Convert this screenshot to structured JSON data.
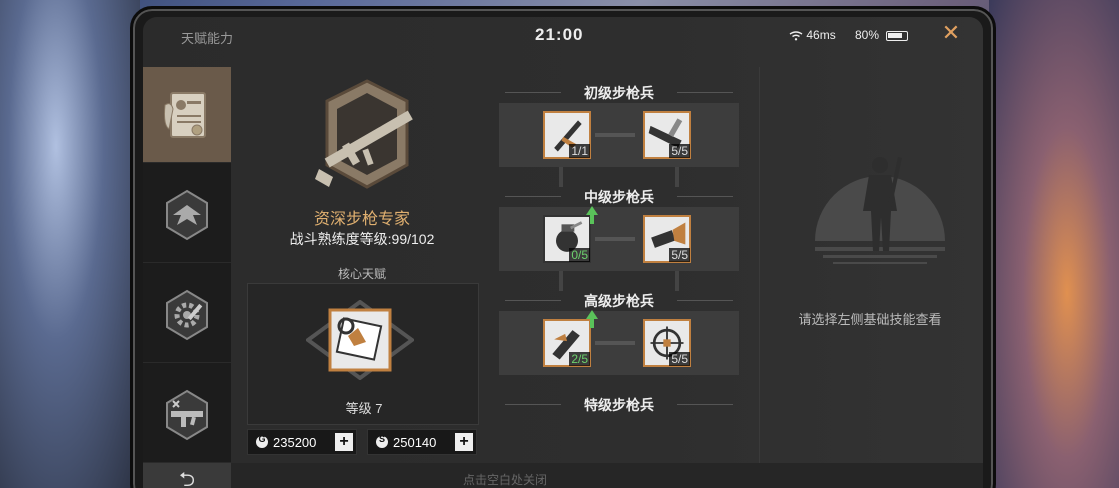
{
  "status_bar": {
    "app_title": "天赋能力",
    "time": "21:00",
    "network": "46ms",
    "battery": "80%"
  },
  "close_icon": "close-icon",
  "sidebar": {
    "tabs": [
      {
        "icon": "certificate-icon",
        "active": true
      },
      {
        "icon": "wing-emblem-icon",
        "active": false
      },
      {
        "icon": "gear-wrench-icon",
        "active": false
      },
      {
        "icon": "rifle-badge-icon",
        "active": false
      }
    ]
  },
  "profile": {
    "emblem_icon": "rifle-emblem-icon",
    "name": "资深步枪专家",
    "proficiency": "战斗熟练度等级:99/102",
    "core_label": "核心天赋",
    "core_level": "等级 7"
  },
  "currency": [
    {
      "icon": "gold-coin-icon",
      "symbol": "G",
      "amount": "235200"
    },
    {
      "icon": "silver-coin-icon",
      "symbol": "S",
      "amount": "250140"
    }
  ],
  "tiers": [
    {
      "title": "初级步枪兵",
      "skills": [
        {
          "count": "1/1",
          "green": false,
          "upgradeable": false
        },
        {
          "count": "5/5",
          "green": false,
          "upgradeable": false
        }
      ]
    },
    {
      "title": "中级步枪兵",
      "skills": [
        {
          "count": "0/5",
          "green": true,
          "upgradeable": true
        },
        {
          "count": "5/5",
          "green": false,
          "upgradeable": false
        }
      ]
    },
    {
      "title": "高级步枪兵",
      "skills": [
        {
          "count": "2/5",
          "green": true,
          "upgradeable": true
        },
        {
          "count": "5/5",
          "green": false,
          "upgradeable": false
        }
      ]
    },
    {
      "title": "特级步枪兵",
      "skills": []
    }
  ],
  "right_panel": {
    "hint": "请选择左侧基础技能查看"
  },
  "bottom": {
    "back_icon": "back-arrow-icon",
    "close_hint": "点击空白处关闭"
  },
  "colors": {
    "accent_orange": "#e0a060",
    "title_gold": "#e0b070",
    "skill_border": "#c08040",
    "green_progress": "#6cd26c"
  }
}
